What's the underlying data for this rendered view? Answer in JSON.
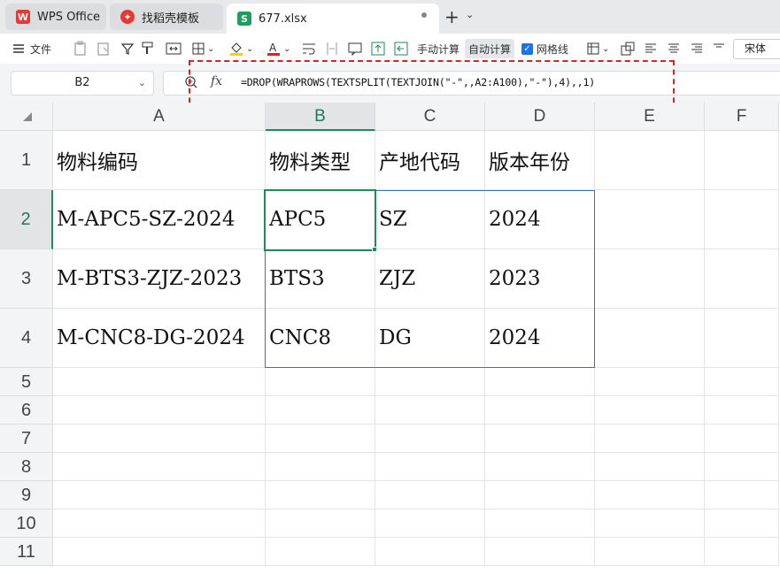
{
  "tabs": [
    {
      "label": "WPS Office",
      "icon": "wps-logo-icon"
    },
    {
      "label": "找稻壳模板",
      "icon": "docer-logo-icon"
    },
    {
      "label": "677.xlsx",
      "icon": "spreadsheet-s-icon",
      "icon_text": "S"
    }
  ],
  "toolbar": {
    "file_label": "文件",
    "manual_calc": "手动计算",
    "auto_calc": "自动计算",
    "gridlines": "网格线",
    "font_name": "宋体"
  },
  "formula_bar": {
    "name_box": "B2",
    "fx_label": "fx",
    "formula": "=DROP(WRAPROWS(TEXTSPLIT(TEXTJOIN(\"-\",,A2:A100),\"-\"),4),,1)"
  },
  "columns": [
    "A",
    "B",
    "C",
    "D",
    "E",
    "F"
  ],
  "rows": [
    "1",
    "2",
    "3",
    "4",
    "5",
    "6",
    "7",
    "8",
    "9",
    "10",
    "11"
  ],
  "cells": [
    [
      "物料编码",
      "物料类型",
      "产地代码",
      "版本年份"
    ],
    [
      "M-APC5-SZ-2024",
      "APC5",
      "SZ",
      "2024"
    ],
    [
      "M-BTS3-ZJZ-2023",
      "BTS3",
      "ZJZ",
      "2023"
    ],
    [
      "M-CNC8-DG-2024",
      "CNC8",
      "DG",
      "2024"
    ]
  ],
  "colors": {
    "selection_green": "#1f8a5a",
    "spill_blue": "#3b6fc4",
    "annotation_red": "#e02020"
  }
}
